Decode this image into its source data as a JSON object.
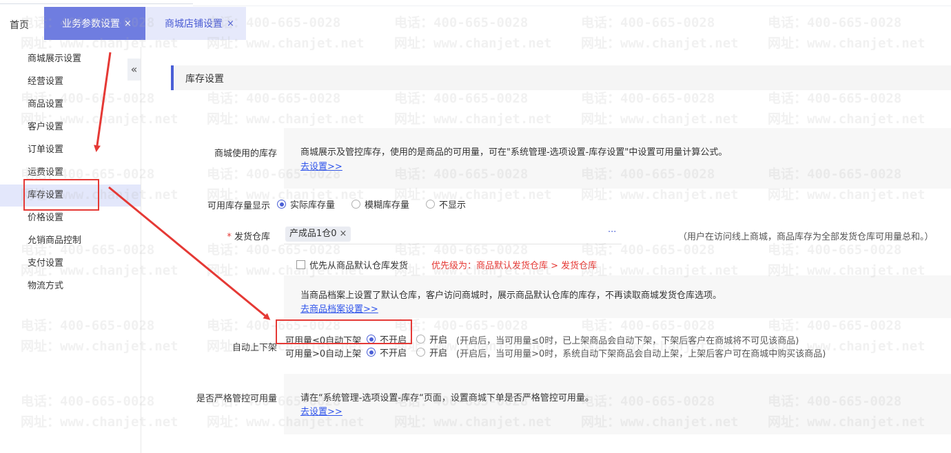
{
  "tabs": {
    "home": "首页",
    "active": {
      "label": "业务参数设置",
      "close": "×"
    },
    "inactive": {
      "label": "商城店铺设置",
      "close": "×"
    }
  },
  "sidebar": {
    "collapse_icon": "«",
    "items": [
      "商城展示设置",
      "经营设置",
      "商品设置",
      "客户设置",
      "订单设置",
      "运费设置",
      "库存设置",
      "价格设置",
      "允销商品控制",
      "支付设置",
      "物流方式"
    ],
    "active_index": 6
  },
  "section": {
    "title": "库存设置"
  },
  "stock_usage": {
    "label": "商城使用的库存",
    "desc": "商城展示及管控库存，使用的是商品的可用量，可在\"系统管理-选项设置-库存设置\"中设置可用量计算公式。",
    "link": "去设置>>"
  },
  "stock_display": {
    "label": "可用库存量显示",
    "options": [
      "实际库存量",
      "模糊库存量",
      "不显示"
    ],
    "selected": 0
  },
  "warehouse": {
    "required_mark": "*",
    "label": "发货仓库",
    "tag": "产成品1仓0",
    "tag_close": "×",
    "more": "···",
    "note": "（用户在访问线上商城，商品库存为全部发货仓库可用量总和。）"
  },
  "default_warehouse": {
    "checkbox_label": "优先从商品默认仓库发货",
    "priority": "优先级为：商品默认发货仓库 > 发货仓库",
    "desc": "当商品档案上设置了默认仓库，客户访问商城时，展示商品默认仓库的库存，不再读取商城发货仓库选项。",
    "link": "去商品档案设置>>"
  },
  "auto_shelf": {
    "label": "自动上下架",
    "rows": [
      {
        "label": "可用量≤0自动下架",
        "options": [
          "不开启",
          "开启"
        ],
        "selected": 0,
        "hint": "(开启后，当可用量≤0时，已上架商品会自动下架，下架后客户在商城将不可见该商品)"
      },
      {
        "label": "可用量>0自动上架",
        "options": [
          "不开启",
          "开启"
        ],
        "selected": 0,
        "hint": "(开启后，当可用量>0时，系统自动下架商品会自动上架，上架后客户可在商城中购买该商品)"
      }
    ]
  },
  "strict_control": {
    "label": "是否严格管控可用量",
    "desc": "请在“系统管理-选项设置-库存“页面，设置商城下单是否严格管控可用量。",
    "link": "去设置>>"
  },
  "watermark": {
    "phone": "电话：400-665-0028",
    "site": "网址：www.chanjet.net"
  },
  "colors": {
    "accent": "#4a5fd6",
    "tab_active": "#6f7de0",
    "annotation": "#e53935"
  }
}
